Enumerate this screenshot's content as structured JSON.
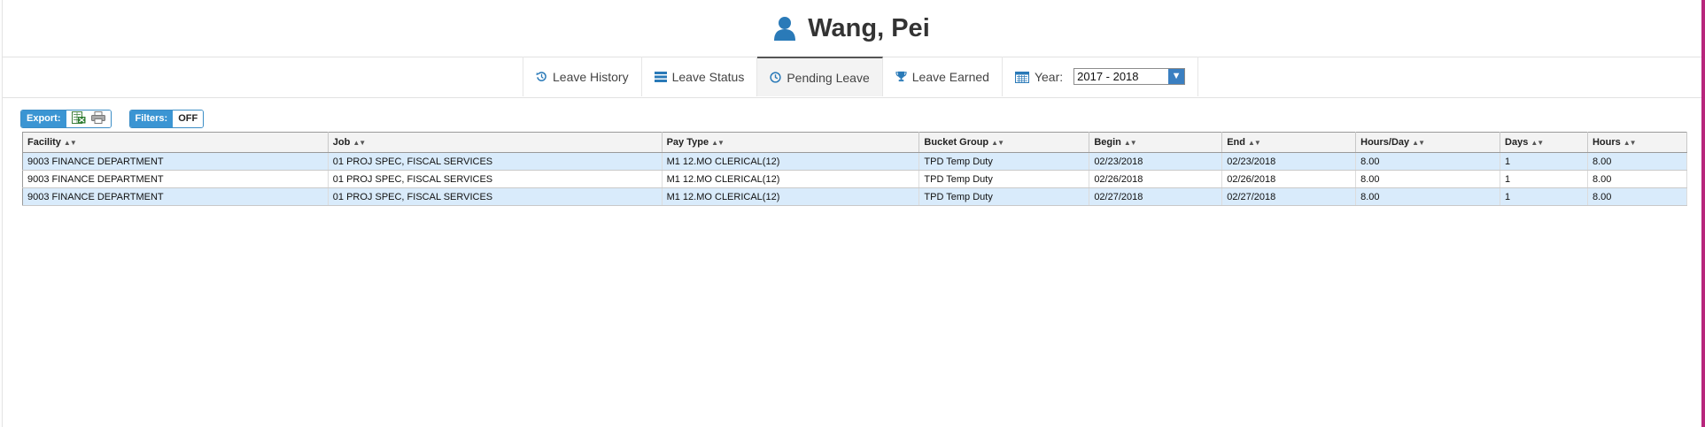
{
  "header": {
    "name": "Wang, Pei",
    "icon": "user-icon"
  },
  "tabs": [
    {
      "label": "Leave History",
      "icon": "history-icon"
    },
    {
      "label": "Leave Status",
      "icon": "list-icon"
    },
    {
      "label": "Pending Leave",
      "icon": "clock-icon",
      "active": true
    },
    {
      "label": "Leave Earned",
      "icon": "trophy-icon"
    }
  ],
  "year": {
    "label": "Year:",
    "value": "2017 - 2018",
    "icon": "calendar-icon"
  },
  "toolbar": {
    "export_label": "Export:",
    "filters_label": "Filters:",
    "filters_value": "OFF"
  },
  "table": {
    "columns": [
      "Facility",
      "Job",
      "Pay Type",
      "Bucket Group",
      "Begin",
      "End",
      "Hours/Day",
      "Days",
      "Hours"
    ],
    "rows": [
      [
        "9003 FINANCE DEPARTMENT",
        "01 PROJ SPEC, FISCAL SERVICES",
        "M1 12.MO CLERICAL(12)",
        "TPD Temp Duty",
        "02/23/2018",
        "02/23/2018",
        "8.00",
        "1",
        "8.00"
      ],
      [
        "9003 FINANCE DEPARTMENT",
        "01 PROJ SPEC, FISCAL SERVICES",
        "M1 12.MO CLERICAL(12)",
        "TPD Temp Duty",
        "02/26/2018",
        "02/26/2018",
        "8.00",
        "1",
        "8.00"
      ],
      [
        "9003 FINANCE DEPARTMENT",
        "01 PROJ SPEC, FISCAL SERVICES",
        "M1 12.MO CLERICAL(12)",
        "TPD Temp Duty",
        "02/27/2018",
        "02/27/2018",
        "8.00",
        "1",
        "8.00"
      ]
    ]
  },
  "colors": {
    "accent": "#3b95d3",
    "row_highlight": "#d9ebfb",
    "icon_blue": "#2a7ab8"
  }
}
